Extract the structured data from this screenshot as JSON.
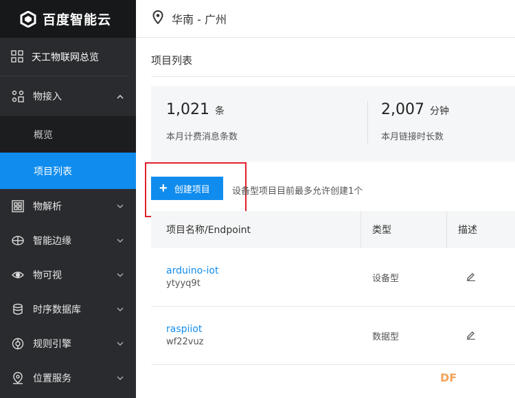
{
  "brand": {
    "name": "百度智能云"
  },
  "header": {
    "region": "华南 - 广州"
  },
  "sidebar": {
    "overview": "天工物联网总览",
    "items": [
      {
        "label": "物接入",
        "icon": "device-access-icon",
        "expanded": true,
        "children": [
          {
            "label": "概览"
          },
          {
            "label": "项目列表",
            "active": true
          }
        ]
      },
      {
        "label": "物解析",
        "icon": "parse-icon"
      },
      {
        "label": "智能边缘",
        "icon": "edge-icon"
      },
      {
        "label": "物可视",
        "icon": "eye-icon"
      },
      {
        "label": "时序数据库",
        "icon": "database-icon"
      },
      {
        "label": "规则引擎",
        "icon": "rule-engine-icon"
      },
      {
        "label": "位置服务",
        "icon": "location-service-icon"
      }
    ]
  },
  "main": {
    "title": "项目列表",
    "stats": [
      {
        "value": "1,021",
        "unit": "条",
        "caption": "本月计费消息条数"
      },
      {
        "value": "2,007",
        "unit": "分钟",
        "caption": "本月链接时长数"
      }
    ],
    "create_button": "创建项目",
    "create_hint": "设备型项目目前最多允许创建1个",
    "table": {
      "columns": [
        "项目名称/Endpoint",
        "类型",
        "描述"
      ],
      "rows": [
        {
          "name": "arduino-iot",
          "endpoint": "ytyyq9t",
          "type": "设备型"
        },
        {
          "name": "raspiiot",
          "endpoint": "wf22vuz",
          "type": "数据型"
        }
      ]
    }
  },
  "watermark": "DF",
  "colors": {
    "accent": "#108cee",
    "sidebar_bg": "#2a2b2e",
    "highlight": "#e0202a"
  }
}
